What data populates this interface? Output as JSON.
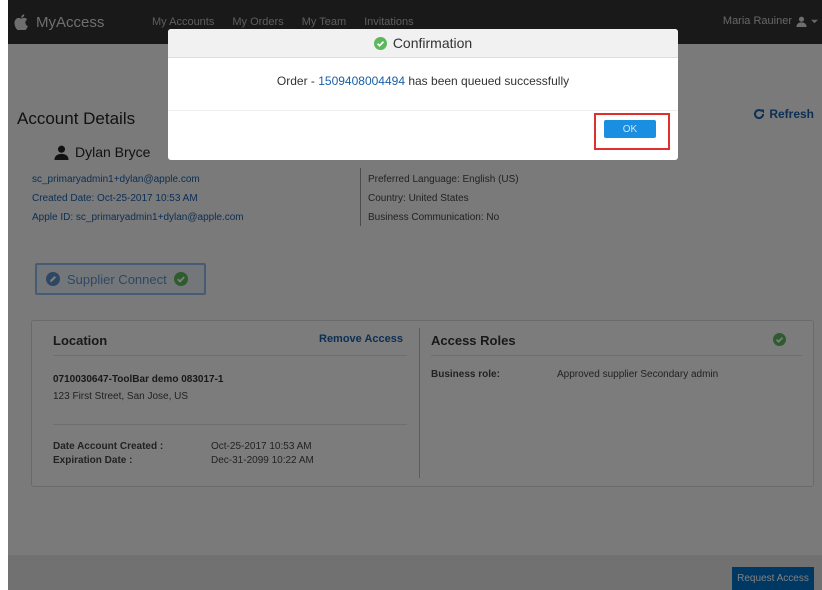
{
  "nav": {
    "brand": "MyAccess",
    "links": [
      "My Accounts",
      "My Orders",
      "My Team",
      "Invitations"
    ],
    "user": "Maria Rauiner"
  },
  "header": {
    "title": "Account Details",
    "refresh_label": "Refresh"
  },
  "account": {
    "name": "Dylan Bryce",
    "email": "sc_primaryadmin1+dylan@apple.com",
    "created": "Created Date:  Oct-25-2017 10:53 AM",
    "apple_id": "Apple ID:  sc_primaryadmin1+dylan@apple.com",
    "language": "Preferred Language: English (US)",
    "country": "Country: United States",
    "business_comm": "Business Communication: No"
  },
  "supplier_button": "Supplier Connect",
  "location_card": {
    "location_heading": "Location",
    "remove_access": "Remove Access",
    "access_heading": "Access Roles",
    "location_name": "0710030647-ToolBar demo 083017-1",
    "address": "123 First Street, San Jose, US",
    "date_created_label": "Date Account Created :",
    "date_created_value": "Oct-25-2017 10:53 AM",
    "expiration_label": "Expiration Date :",
    "expiration_value": "Dec-31-2099 10:22 AM",
    "business_role_label": "Business role:",
    "business_role_value": "Approved supplier Secondary admin"
  },
  "footer": {
    "request_access": "Request Access"
  },
  "modal": {
    "title": "Confirmation",
    "message_prefix": "Order - ",
    "order_number": "1509408004494",
    "message_suffix": " has been queued successfully",
    "ok_label": "OK"
  },
  "colors": {
    "accent": "#1a5ea8",
    "success": "#5cb85c",
    "highlight": "#e0302b",
    "nav_bg": "#333333"
  }
}
